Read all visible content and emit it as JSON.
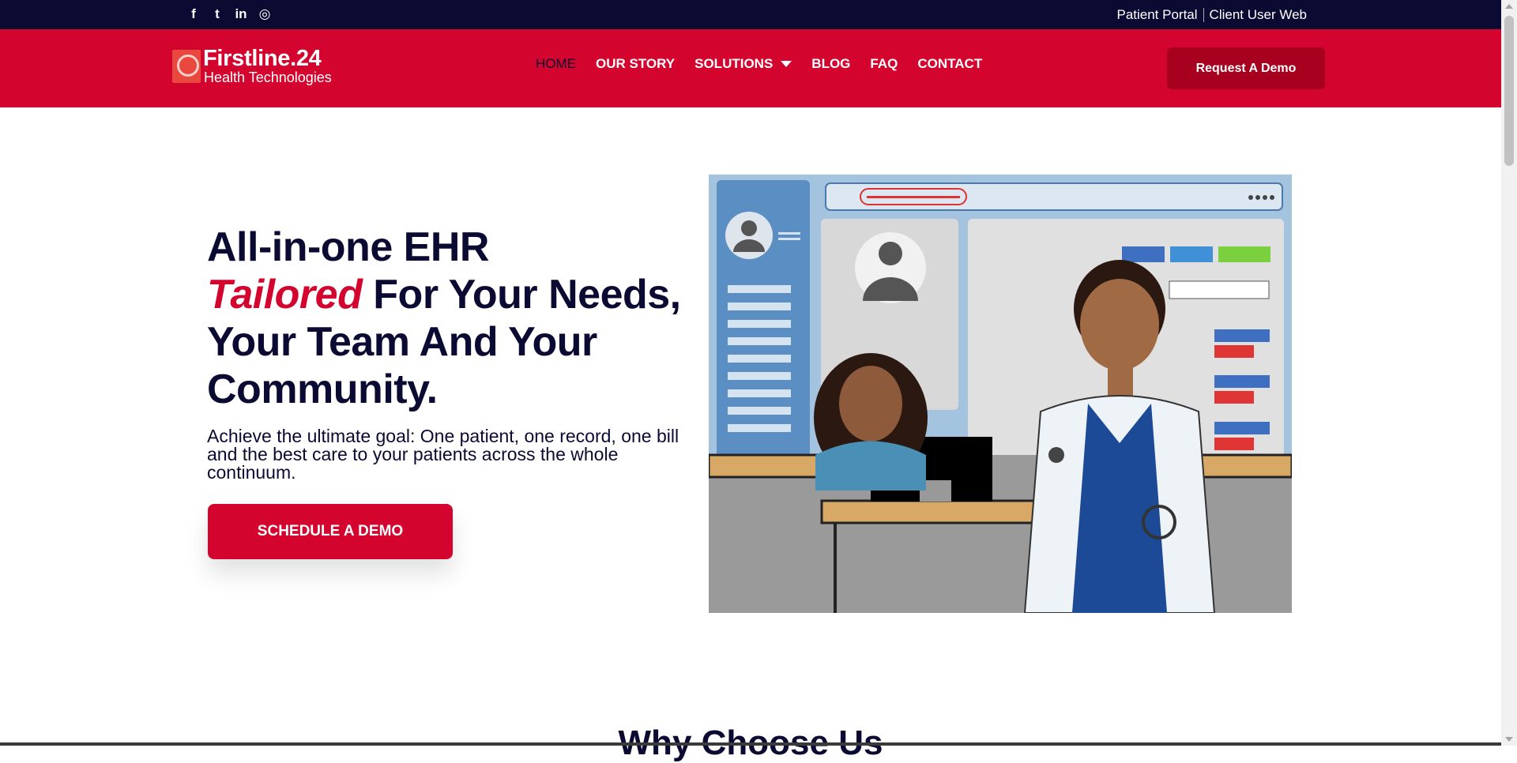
{
  "topbar": {
    "social": [
      {
        "icon": "facebook-icon",
        "glyph": "f"
      },
      {
        "icon": "twitter-icon",
        "glyph": "t"
      },
      {
        "icon": "linkedin-icon",
        "glyph": "in"
      },
      {
        "icon": "instagram-icon",
        "glyph": "◎"
      }
    ],
    "links": [
      "Patient Portal",
      "Client User Web"
    ]
  },
  "header": {
    "logo_name": "Firstline.24",
    "logo_sub": "Health Technologies",
    "nav": [
      "HOME",
      "OUR STORY",
      "SOLUTIONS",
      "BLOG",
      "FAQ",
      "CONTACT"
    ],
    "demo_button": "Request A Demo"
  },
  "hero": {
    "title_line1": "All-in-one EHR",
    "title_accent": "Tailored",
    "title_rest": " For Your Needs, Your Team And Your Community.",
    "description": "Achieve the ultimate goal: One patient, one record, one bill and the best care to your  patients across the whole continuum.",
    "cta": "SCHEDULE A DEMO"
  },
  "section": {
    "title": "Why Choose Us"
  },
  "colors": {
    "brand_red": "#d3042d",
    "navy": "#0b0a33",
    "dark_red": "#a8001f"
  }
}
